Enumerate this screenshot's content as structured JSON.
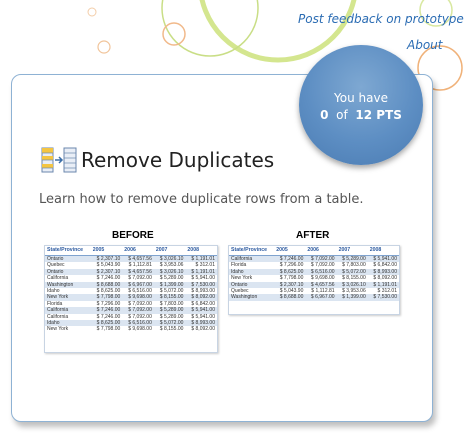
{
  "links": {
    "feedback": "Post feedback on prototype",
    "about": "About"
  },
  "badge": {
    "line1": "You have",
    "points": "0",
    "of": "of",
    "total": "12 PTS"
  },
  "lesson": {
    "title": "Remove Duplicates",
    "subtitle": "Learn how to remove duplicate rows from a table.",
    "before_label": "BEFORE",
    "after_label": "AFTER",
    "icon": "remove-duplicates-icon"
  },
  "table_headers": [
    "State/Province",
    "2005",
    "2006",
    "2007",
    "2008"
  ],
  "before_rows": [
    [
      "Ontario",
      "$ 2,307.10",
      "$ 4,657.56",
      "$ 3,026.10",
      "$ 1,191.01"
    ],
    [
      "Quebec",
      "$ 5,043.90",
      "$ 1,112.81",
      "$ 3,953.06",
      "$ 312.01"
    ],
    [
      "Ontario",
      "$ 2,307.10",
      "$ 4,657.56",
      "$ 3,026.10",
      "$ 1,191.01"
    ],
    [
      "California",
      "$ 7,246.00",
      "$ 7,092.00",
      "$ 5,289.00",
      "$ 5,941.00"
    ],
    [
      "Washington",
      "$ 8,688.00",
      "$ 6,967.00",
      "$ 1,399.00",
      "$ 7,530.00"
    ],
    [
      "Idaho",
      "$ 8,625.00",
      "$ 6,516.00",
      "$ 5,072.00",
      "$ 8,993.00"
    ],
    [
      "New York",
      "$ 7,798.00",
      "$ 9,698.00",
      "$ 8,155.00",
      "$ 8,092.00"
    ],
    [
      "Florida",
      "$ 7,296.00",
      "$ 7,092.00",
      "$ 7,803.00",
      "$ 6,842.00"
    ],
    [
      "California",
      "$ 7,246.00",
      "$ 7,092.00",
      "$ 5,289.00",
      "$ 5,941.00"
    ],
    [
      "California",
      "$ 7,246.00",
      "$ 7,092.00",
      "$ 5,289.00",
      "$ 5,941.00"
    ],
    [
      "Idaho",
      "$ 8,625.00",
      "$ 6,516.00",
      "$ 5,072.00",
      "$ 8,993.00"
    ],
    [
      "New York",
      "$ 7,798.00",
      "$ 9,698.00",
      "$ 8,155.00",
      "$ 8,092.00"
    ]
  ],
  "after_rows": [
    [
      "California",
      "$ 7,246.00",
      "$ 7,092.00",
      "$ 5,289.00",
      "$ 5,941.00"
    ],
    [
      "Florida",
      "$ 7,296.00",
      "$ 7,092.00",
      "$ 7,803.00",
      "$ 6,842.00"
    ],
    [
      "Idaho",
      "$ 8,625.00",
      "$ 6,516.00",
      "$ 5,072.00",
      "$ 8,993.00"
    ],
    [
      "New York",
      "$ 7,798.00",
      "$ 9,698.00",
      "$ 8,155.00",
      "$ 8,092.00"
    ],
    [
      "Ontario",
      "$ 2,307.10",
      "$ 4,657.56",
      "$ 3,026.10",
      "$ 1,191.01"
    ],
    [
      "Quebec",
      "$ 5,043.90",
      "$ 1,112.81",
      "$ 3,953.06",
      "$ 312.01"
    ],
    [
      "Washington",
      "$ 8,688.00",
      "$ 6,967.00",
      "$ 1,399.00",
      "$ 7,530.00"
    ]
  ],
  "colors": {
    "accent_blue": "#2b6cb3",
    "badge_blue": "#5d8ec3",
    "circle_green": "#c6dc7a",
    "circle_orange": "#f0b27a"
  }
}
